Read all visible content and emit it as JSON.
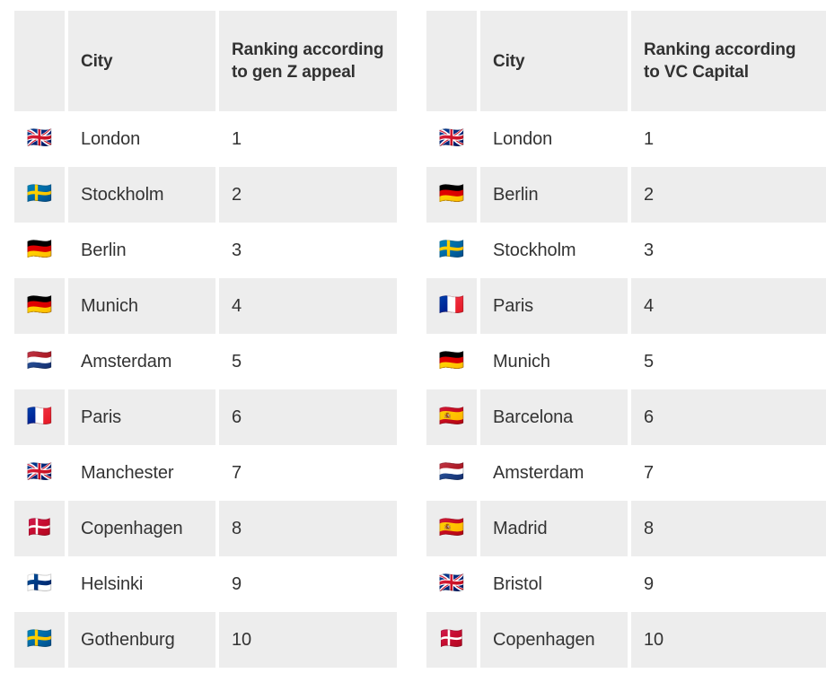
{
  "tables": [
    {
      "id": "gen-z-appeal",
      "headers": {
        "flag": "",
        "city": "City",
        "rank": "Ranking according to gen Z appeal"
      },
      "rows": [
        {
          "flag": "🇬🇧",
          "flag_name": "flag-united-kingdom",
          "city": "London",
          "rank": "1"
        },
        {
          "flag": "🇸🇪",
          "flag_name": "flag-sweden",
          "city": "Stockholm",
          "rank": "2"
        },
        {
          "flag": "🇩🇪",
          "flag_name": "flag-germany",
          "city": "Berlin",
          "rank": "3"
        },
        {
          "flag": "🇩🇪",
          "flag_name": "flag-germany",
          "city": "Munich",
          "rank": "4"
        },
        {
          "flag": "🇳🇱",
          "flag_name": "flag-netherlands",
          "city": "Amsterdam",
          "rank": "5"
        },
        {
          "flag": "🇫🇷",
          "flag_name": "flag-france",
          "city": "Paris",
          "rank": "6"
        },
        {
          "flag": "🇬🇧",
          "flag_name": "flag-united-kingdom",
          "city": "Manchester",
          "rank": "7"
        },
        {
          "flag": "🇩🇰",
          "flag_name": "flag-denmark",
          "city": "Copenhagen",
          "rank": "8"
        },
        {
          "flag": "🇫🇮",
          "flag_name": "flag-finland",
          "city": "Helsinki",
          "rank": "9"
        },
        {
          "flag": "🇸🇪",
          "flag_name": "flag-sweden",
          "city": "Gothenburg",
          "rank": "10"
        }
      ]
    },
    {
      "id": "vc-capital",
      "headers": {
        "flag": "",
        "city": "City",
        "rank": "Ranking according to VC Capital"
      },
      "rows": [
        {
          "flag": "🇬🇧",
          "flag_name": "flag-united-kingdom",
          "city": "London",
          "rank": "1"
        },
        {
          "flag": "🇩🇪",
          "flag_name": "flag-germany",
          "city": "Berlin",
          "rank": "2"
        },
        {
          "flag": "🇸🇪",
          "flag_name": "flag-sweden",
          "city": "Stockholm",
          "rank": "3"
        },
        {
          "flag": "🇫🇷",
          "flag_name": "flag-france",
          "city": "Paris",
          "rank": "4"
        },
        {
          "flag": "🇩🇪",
          "flag_name": "flag-germany",
          "city": "Munich",
          "rank": "5"
        },
        {
          "flag": "🇪🇸",
          "flag_name": "flag-spain",
          "city": "Barcelona",
          "rank": "6"
        },
        {
          "flag": "🇳🇱",
          "flag_name": "flag-netherlands",
          "city": "Amsterdam",
          "rank": "7"
        },
        {
          "flag": "🇪🇸",
          "flag_name": "flag-spain",
          "city": "Madrid",
          "rank": "8"
        },
        {
          "flag": "🇬🇧",
          "flag_name": "flag-united-kingdom",
          "city": "Bristol",
          "rank": "9"
        },
        {
          "flag": "🇩🇰",
          "flag_name": "flag-denmark",
          "city": "Copenhagen",
          "rank": "10"
        }
      ]
    }
  ],
  "colors": {
    "page_background": "#ffffff",
    "header_background": "#ededed",
    "stripe_background": "#ededed",
    "row_background": "#ffffff",
    "text": "#333333",
    "header_text": "#313131"
  }
}
